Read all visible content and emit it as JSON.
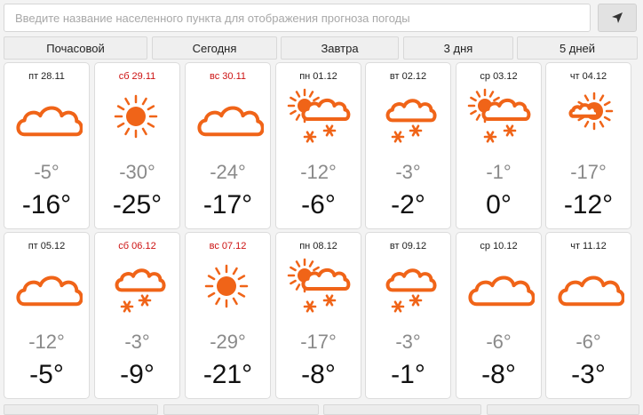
{
  "search": {
    "placeholder": "Введите название населенного пункта для отображения прогноза погоды"
  },
  "tabs": [
    {
      "label": "Почасовой"
    },
    {
      "label": "Сегодня"
    },
    {
      "label": "Завтра"
    },
    {
      "label": "3 дня"
    },
    {
      "label": "5 дней"
    }
  ],
  "accent_color": "#f06418",
  "weekend_color": "#cc1111",
  "days": [
    {
      "date": "пт 28.11",
      "weekend": false,
      "icon": "cloudy-icon",
      "tmin": "-5°",
      "tmax": "-16°"
    },
    {
      "date": "сб 29.11",
      "weekend": true,
      "icon": "sun-icon",
      "tmin": "-30°",
      "tmax": "-25°"
    },
    {
      "date": "вс 30.11",
      "weekend": true,
      "icon": "cloudy-icon",
      "tmin": "-24°",
      "tmax": "-17°"
    },
    {
      "date": "пн 01.12",
      "weekend": false,
      "icon": "sun-cloud-snow-icon",
      "tmin": "-12°",
      "tmax": "-6°"
    },
    {
      "date": "вт 02.12",
      "weekend": false,
      "icon": "cloud-snow-icon",
      "tmin": "-3°",
      "tmax": "-2°"
    },
    {
      "date": "ср 03.12",
      "weekend": false,
      "icon": "sun-cloud-snow-icon",
      "tmin": "-1°",
      "tmax": "0°"
    },
    {
      "date": "чт 04.12",
      "weekend": false,
      "icon": "sun-small-cloud-icon",
      "tmin": "-17°",
      "tmax": "-12°"
    },
    {
      "date": "пт 05.12",
      "weekend": false,
      "icon": "cloudy-icon",
      "tmin": "-12°",
      "tmax": "-5°"
    },
    {
      "date": "сб 06.12",
      "weekend": true,
      "icon": "cloud-snow-icon",
      "tmin": "-3°",
      "tmax": "-9°"
    },
    {
      "date": "вс 07.12",
      "weekend": true,
      "icon": "sun-icon",
      "tmin": "-29°",
      "tmax": "-21°"
    },
    {
      "date": "пн 08.12",
      "weekend": false,
      "icon": "sun-cloud-snow-icon",
      "tmin": "-17°",
      "tmax": "-8°"
    },
    {
      "date": "вт 09.12",
      "weekend": false,
      "icon": "cloud-snow-icon",
      "tmin": "-3°",
      "tmax": "-1°"
    },
    {
      "date": "ср 10.12",
      "weekend": false,
      "icon": "cloudy-icon",
      "tmin": "-6°",
      "tmax": "-8°"
    },
    {
      "date": "чт 11.12",
      "weekend": false,
      "icon": "cloudy-icon",
      "tmin": "-6°",
      "tmax": "-3°"
    }
  ]
}
